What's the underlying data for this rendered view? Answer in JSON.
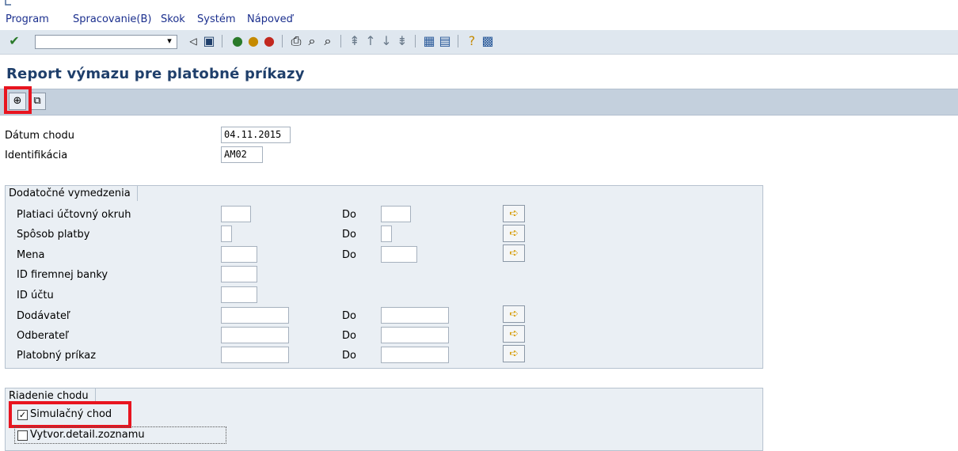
{
  "menu": {
    "items": [
      {
        "label": "Program"
      },
      {
        "label": "Spracovanie(B)"
      },
      {
        "label": "Skok"
      },
      {
        "label": "Systém"
      },
      {
        "label": "Nápoveď"
      }
    ]
  },
  "toolbar": {
    "ok_code_value": "",
    "icons": [
      "enter-icon",
      "history-icon",
      "back-icon",
      "save-icon",
      "back-nav-icon",
      "exit-icon",
      "cancel-icon",
      "print-icon",
      "find-icon",
      "find-next-icon",
      "first-page-icon",
      "previous-page-icon",
      "next-page-icon",
      "last-page-icon",
      "new-session-icon",
      "shortcut-icon",
      "help-icon",
      "layout-menu-icon"
    ]
  },
  "title": "Report výmazu pre platobné príkazy",
  "app_toolbar": {
    "execute_icon": "execute-icon",
    "variant_icon": "variant-icon"
  },
  "header_fields": {
    "run_date": {
      "label": "Dátum chodu",
      "value": "04.11.2015"
    },
    "identification": {
      "label": "Identifikácia",
      "value": "AM02"
    }
  },
  "additional": {
    "title": "Dodatočné vymedzenia",
    "to_label": "Do",
    "rows": [
      {
        "label": "Platiaci účtovný okruh",
        "from": "",
        "to": ""
      },
      {
        "label": "Spôsob platby",
        "from": "",
        "to": ""
      },
      {
        "label": "Mena",
        "from": "",
        "to": ""
      },
      {
        "label": "ID firemnej banky",
        "from": ""
      },
      {
        "label": "ID účtu",
        "from": ""
      },
      {
        "label": "Dodávateľ",
        "from": "",
        "to": ""
      },
      {
        "label": "Odberateľ",
        "from": "",
        "to": ""
      },
      {
        "label": "Platobný príkaz",
        "from": "",
        "to": ""
      }
    ]
  },
  "run_control": {
    "title": "Riadenie chodu",
    "simulation": {
      "label": "Simulačný chod",
      "checked": true
    },
    "detail_list": {
      "label": "Vytvor.detail.zoznamu",
      "checked": false
    }
  },
  "colors": {
    "highlight": "#e8141f",
    "title": "#1f3f6b",
    "menu": "#1b2f8e"
  }
}
